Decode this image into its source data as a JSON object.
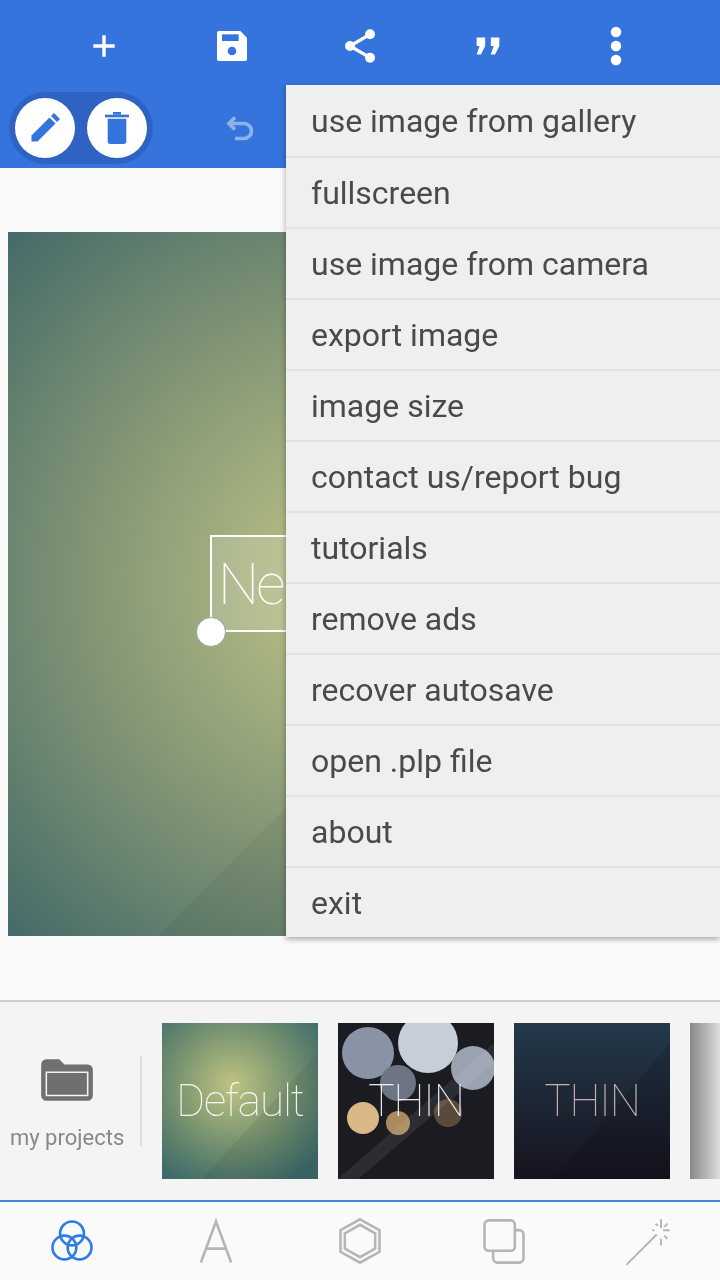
{
  "toolbar": {
    "actions": [
      {
        "kind": "add"
      },
      {
        "kind": "save"
      },
      {
        "kind": "share"
      },
      {
        "kind": "quote"
      },
      {
        "kind": "more"
      }
    ]
  },
  "edit_tools": [
    {
      "kind": "edit"
    },
    {
      "kind": "delete"
    }
  ],
  "undo": {
    "disabled": true
  },
  "canvas": {
    "text": "Ne"
  },
  "menu": {
    "items": [
      "use image from gallery",
      "fullscreen",
      "use image from camera",
      "export image",
      "image size",
      "contact us/report bug",
      "tutorials",
      "remove ads",
      "recover autosave",
      "open .plp file",
      "about",
      "exit"
    ]
  },
  "projects": {
    "label": "my projects"
  },
  "templates": [
    {
      "label": "Default",
      "kind": "green"
    },
    {
      "label": "THIN",
      "kind": "bokeh"
    },
    {
      "label": "THIN",
      "kind": "dark"
    }
  ],
  "bottom_tabs": [
    {
      "kind": "color",
      "selected": true
    },
    {
      "kind": "text",
      "selected": false
    },
    {
      "kind": "shape",
      "selected": false
    },
    {
      "kind": "layers",
      "selected": false
    },
    {
      "kind": "effects",
      "selected": false
    }
  ]
}
